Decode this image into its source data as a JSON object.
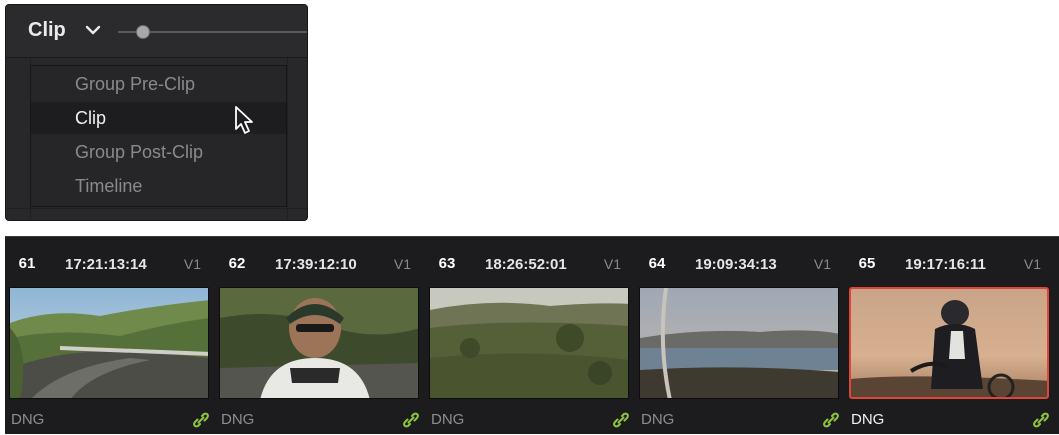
{
  "mode_selector": {
    "current": "Clip",
    "zoom_level": 0.1,
    "options": [
      {
        "label": "Group Pre-Clip",
        "active": false
      },
      {
        "label": "Clip",
        "active": true
      },
      {
        "label": "Group Post-Clip",
        "active": false
      },
      {
        "label": "Timeline",
        "active": false
      }
    ]
  },
  "clips": [
    {
      "number": "61",
      "timecode": "17:21:13:14",
      "track": "V1",
      "format": "DNG",
      "selected": false,
      "thumbnail": "road-curve-coast"
    },
    {
      "number": "62",
      "timecode": "17:39:12:10",
      "track": "V1",
      "format": "DNG",
      "selected": false,
      "thumbnail": "cyclist-front"
    },
    {
      "number": "63",
      "timecode": "18:26:52:01",
      "track": "V1",
      "format": "DNG",
      "selected": false,
      "thumbnail": "hill-scrub"
    },
    {
      "number": "64",
      "timecode": "19:09:34:13",
      "track": "V1",
      "format": "DNG",
      "selected": false,
      "thumbnail": "bay-view"
    },
    {
      "number": "65",
      "timecode": "19:17:16:11",
      "track": "V1",
      "format": "DNG",
      "selected": true,
      "thumbnail": "cyclist-sunset"
    }
  ],
  "colors": {
    "selected_border": "#e0453a",
    "link_icon": "#8ec63f"
  }
}
